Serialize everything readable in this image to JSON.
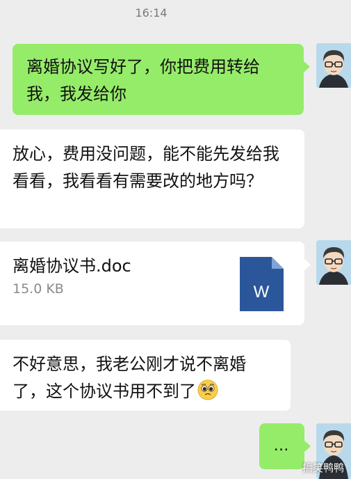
{
  "status": {
    "time": "16:14"
  },
  "messages": [
    {
      "side": "right",
      "text": "离婚协议写好了，你把费用转给我，我发给你"
    },
    {
      "side": "left",
      "text": "放心，费用没问题，能不能先发给我看看，我看看有需要改的地方吗？"
    },
    {
      "side": "right",
      "type": "file",
      "file_name": "离婚协议书.doc",
      "file_size": "15.0 KB",
      "file_icon_letter": "W"
    },
    {
      "side": "left",
      "text": "不好意思，我老公刚才说不离婚了，这个协议书用不到了"
    },
    {
      "side": "right",
      "text": "…"
    }
  ],
  "icons": {
    "avatar": "avatar-cartoon-man-glasses",
    "file": "word-document-icon",
    "emoji": "pleading-face-emoji"
  },
  "watermark": "搞笑鸭鸭",
  "colors": {
    "sent_bubble": "#95ec69",
    "received_bubble": "#ffffff",
    "background": "#ededed",
    "word_blue": "#2b579a"
  }
}
